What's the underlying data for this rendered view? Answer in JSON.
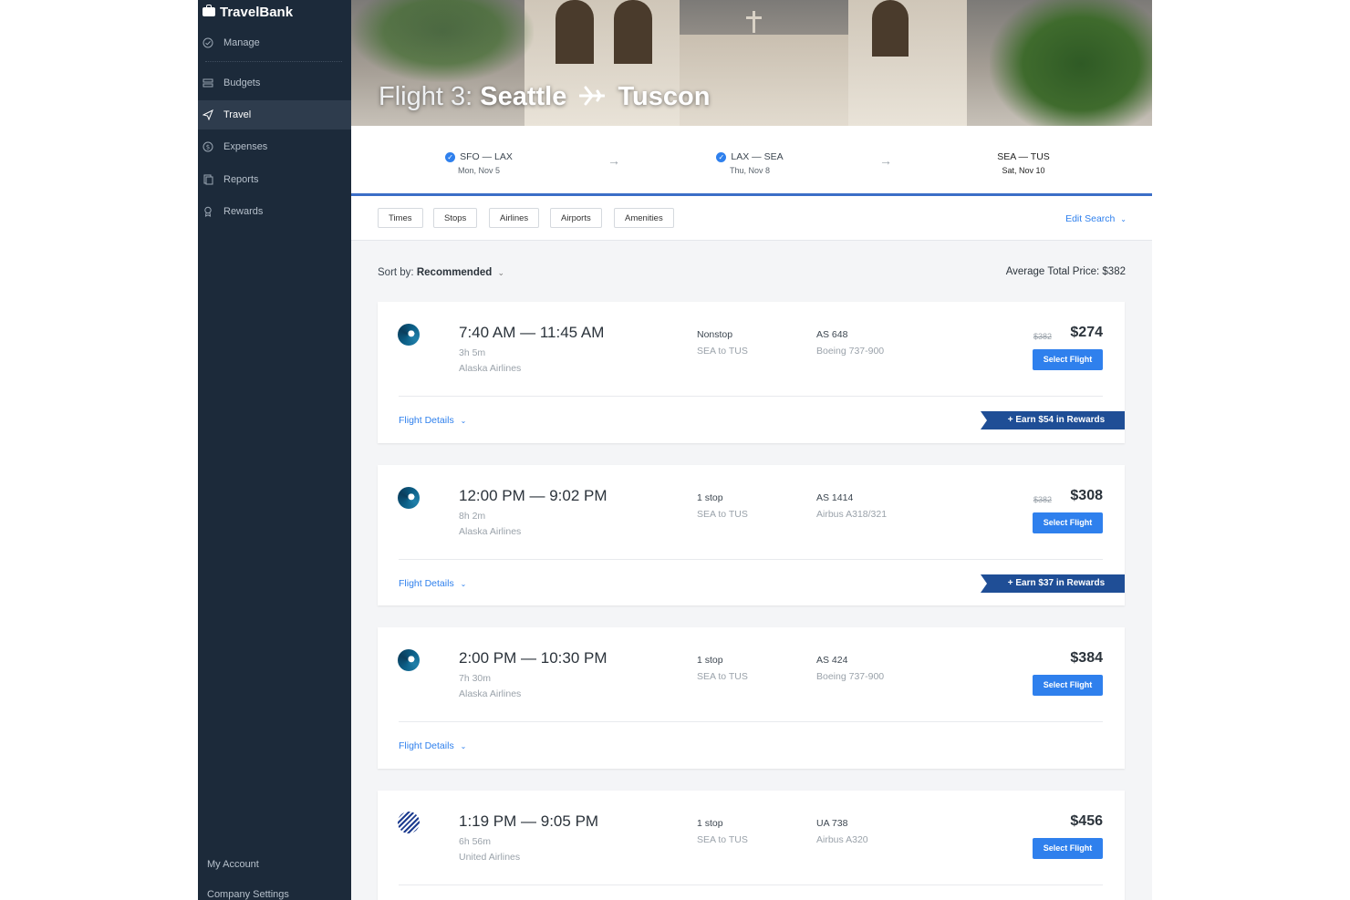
{
  "sidebar": {
    "brand": "TravelBank",
    "items": [
      {
        "label": "Manage",
        "icon": "check-circle-icon"
      },
      {
        "label": "Budgets",
        "icon": "budget-icon"
      },
      {
        "label": "Travel",
        "icon": "plane-icon",
        "active": true
      },
      {
        "label": "Expenses",
        "icon": "dollar-icon"
      },
      {
        "label": "Reports",
        "icon": "report-icon"
      },
      {
        "label": "Rewards",
        "icon": "ribbon-icon"
      }
    ],
    "my_account": "My Account",
    "company_settings": "Company Settings"
  },
  "header": {
    "flight_prefix": "Flight 3:",
    "origin": "Seattle",
    "destination": "Tuscon"
  },
  "legs": [
    {
      "route": "SFO — LAX",
      "date": "Mon, Nov 5",
      "completed": true
    },
    {
      "route": "LAX — SEA",
      "date": "Thu, Nov 8",
      "completed": true
    },
    {
      "route": "SEA — TUS",
      "date": "Sat, Nov 10",
      "completed": false
    }
  ],
  "filters": {
    "times": "Times",
    "stops": "Stops",
    "airlines": "Airlines",
    "airports": "Airports",
    "amenities": "Amenities",
    "edit_search": "Edit Search"
  },
  "sort": {
    "label": "Sort by:",
    "value": "Recommended",
    "avg_label": "Average Total Price:",
    "avg_value": "$382"
  },
  "flights": [
    {
      "times": "7:40 AM — 11:45 AM",
      "duration": "3h 5m",
      "airline": "Alaska Airlines",
      "stops": "Nonstop",
      "route": "SEA to TUS",
      "flight_no": "AS 648",
      "aircraft": "Boeing 737-900",
      "old_price": "$382",
      "price": "$274",
      "select": "Select Flight",
      "details": "Flight Details",
      "rewards": "+ Earn $54 in Rewards"
    },
    {
      "times": "12:00 PM — 9:02 PM",
      "duration": "8h 2m",
      "airline": "Alaska Airlines",
      "stops": "1 stop",
      "route": "SEA to TUS",
      "flight_no": "AS 1414",
      "aircraft": "Airbus A318/321",
      "old_price": "$382",
      "price": "$308",
      "select": "Select Flight",
      "details": "Flight Details",
      "rewards": "+ Earn $37 in Rewards"
    },
    {
      "times": "2:00 PM — 10:30 PM",
      "duration": "7h 30m",
      "airline": "Alaska Airlines",
      "stops": "1 stop",
      "route": "SEA to TUS",
      "flight_no": "AS 424",
      "aircraft": "Boeing 737-900",
      "price": "$384",
      "select": "Select Flight",
      "details": "Flight Details"
    },
    {
      "times": "1:19 PM — 9:05 PM",
      "duration": "6h 56m",
      "airline": "United Airlines",
      "stops": "1 stop",
      "route": "SEA to TUS",
      "flight_no": "UA 738",
      "aircraft": "Airbus A320",
      "price": "$456",
      "select": "Select Flight"
    }
  ],
  "colors": {
    "sidebar_bg": "#1c2a3a",
    "accent": "#2f80ed",
    "rewards": "#1f4e96"
  }
}
